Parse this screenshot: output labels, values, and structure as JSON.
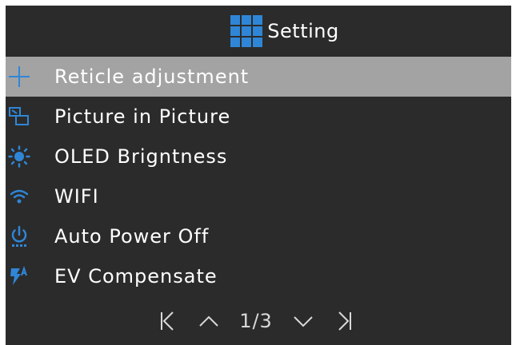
{
  "header": {
    "title": "Setting",
    "icon": "grid-menu-icon"
  },
  "menu": {
    "items": [
      {
        "label": "Reticle adjustment",
        "icon": "crosshair-icon",
        "selected": true
      },
      {
        "label": "Picture in Picture",
        "icon": "picture-in-picture-icon",
        "selected": false
      },
      {
        "label": "OLED Brigntness",
        "icon": "sun-icon",
        "selected": false
      },
      {
        "label": "WIFI",
        "icon": "wifi-icon",
        "selected": false
      },
      {
        "label": "Auto Power Off",
        "icon": "power-icon",
        "selected": false
      },
      {
        "label": "EV Compensate",
        "icon": "exposure-icon",
        "selected": false
      }
    ]
  },
  "pager": {
    "indicator": "1/3",
    "first_icon": "first-page-icon",
    "prev_icon": "chevron-up-icon",
    "next_icon": "chevron-down-icon",
    "last_icon": "last-page-icon"
  },
  "colors": {
    "background": "#2b2b2b",
    "selected_row": "#a3a3a3",
    "accent": "#2f86d6",
    "text": "#ffffff"
  }
}
